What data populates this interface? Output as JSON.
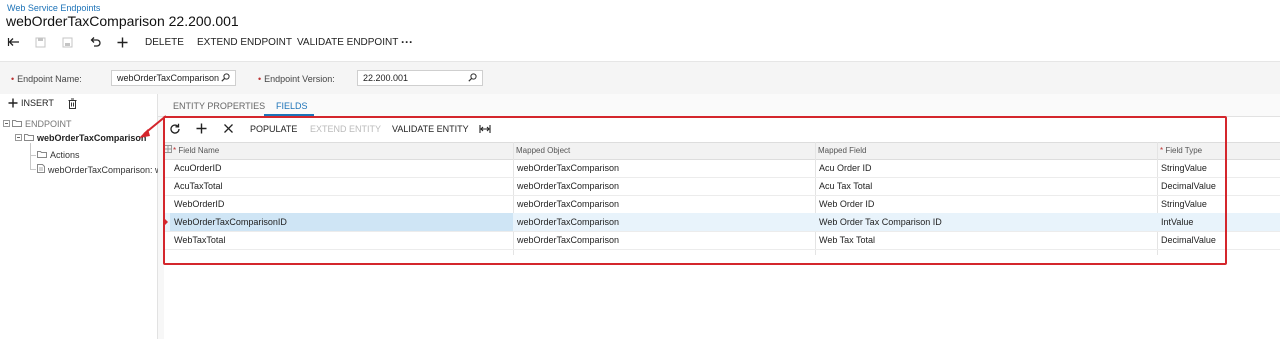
{
  "header": {
    "breadcrumb": "Web Service Endpoints",
    "title": "webOrderTaxComparison 22.200.001"
  },
  "toolbar": {
    "back_icon": "back-arrow-icon",
    "save_icon": "save-icon",
    "save_close_icon": "save-close-icon",
    "undo_icon": "undo-icon",
    "add_icon": "plus-icon",
    "delete_label": "DELETE",
    "extend_label": "EXTEND ENDPOINT",
    "validate_label": "VALIDATE ENDPOINT",
    "more_label": "···"
  },
  "form": {
    "endpoint_name_label": "Endpoint Name:",
    "endpoint_name_value": "webOrderTaxComparison",
    "endpoint_version_label": "Endpoint Version:",
    "endpoint_version_value": "22.200.001"
  },
  "tree": {
    "insert_label": "INSERT",
    "root": "ENDPOINT",
    "entity": "webOrderTaxComparison",
    "actions": "Actions",
    "field_node": "webOrderTaxComparison: we"
  },
  "tabs": [
    {
      "label": "ENTITY PROPERTIES",
      "active": false
    },
    {
      "label": "FIELDS",
      "active": true
    }
  ],
  "grid_toolbar": {
    "refresh_icon": "refresh-icon",
    "add_icon": "plus-icon",
    "delete_icon": "close-icon",
    "populate_label": "POPULATE",
    "extend_entity_label": "EXTEND ENTITY",
    "validate_entity_label": "VALIDATE ENTITY",
    "fit_icon": "fit-columns-icon"
  },
  "grid": {
    "columns": [
      "Field Name",
      "Mapped Object",
      "Mapped Field",
      "Field Type"
    ],
    "rows": [
      {
        "field_name": "AcuOrderID",
        "mapped_object": "webOrderTaxComparison",
        "mapped_field": "Acu Order ID",
        "field_type": "StringValue"
      },
      {
        "field_name": "AcuTaxTotal",
        "mapped_object": "webOrderTaxComparison",
        "mapped_field": "Acu Tax Total",
        "field_type": "DecimalValue"
      },
      {
        "field_name": "WebOrderID",
        "mapped_object": "webOrderTaxComparison",
        "mapped_field": "Web Order ID",
        "field_type": "StringValue"
      },
      {
        "field_name": "WebOrderTaxComparisonID",
        "mapped_object": "webOrderTaxComparison",
        "mapped_field": "Web Order Tax Comparison ID",
        "field_type": "IntValue"
      },
      {
        "field_name": "WebTaxTotal",
        "mapped_object": "webOrderTaxComparison",
        "mapped_field": "Web Tax Total",
        "field_type": "DecimalValue"
      }
    ],
    "selected_row": 3
  },
  "colors": {
    "accent": "#1d73b8",
    "annotation": "#d4262c",
    "selected_row": "#e8f3fb"
  }
}
